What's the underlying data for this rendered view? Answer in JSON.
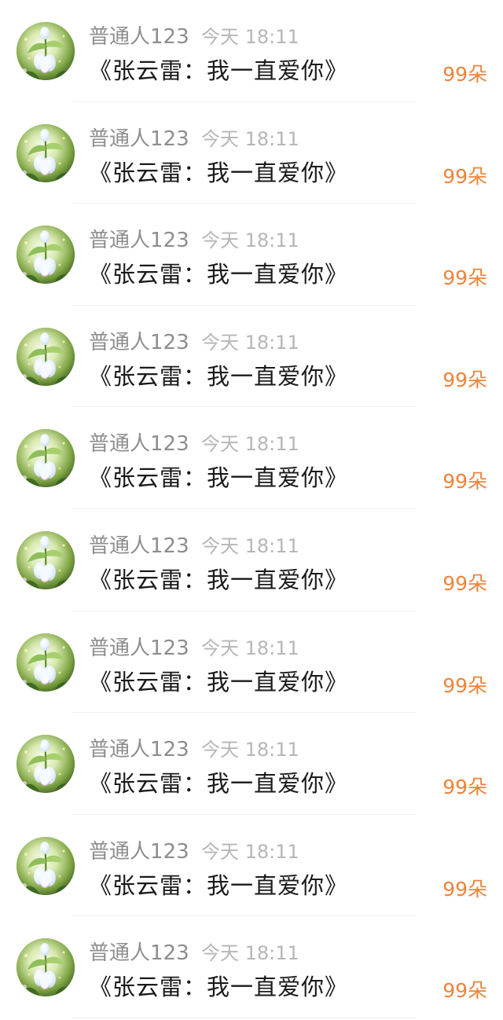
{
  "colors": {
    "background": "#ffffff",
    "name": "#8d8d8d",
    "time": "#b6b6b6",
    "title": "#1a1a1a",
    "count_accent": "#f0833a"
  },
  "avatar_icon": "snowdrop-flower-avatar",
  "items": [
    {
      "name": "普通人123",
      "time": "今天 18:11",
      "title": "《张云雷：我一直爱你》",
      "count": "99朵"
    },
    {
      "name": "普通人123",
      "time": "今天 18:11",
      "title": "《张云雷：我一直爱你》",
      "count": "99朵"
    },
    {
      "name": "普通人123",
      "time": "今天 18:11",
      "title": "《张云雷：我一直爱你》",
      "count": "99朵"
    },
    {
      "name": "普通人123",
      "time": "今天 18:11",
      "title": "《张云雷：我一直爱你》",
      "count": "99朵"
    },
    {
      "name": "普通人123",
      "time": "今天 18:11",
      "title": "《张云雷：我一直爱你》",
      "count": "99朵"
    },
    {
      "name": "普通人123",
      "time": "今天 18:11",
      "title": "《张云雷：我一直爱你》",
      "count": "99朵"
    },
    {
      "name": "普通人123",
      "time": "今天 18:11",
      "title": "《张云雷：我一直爱你》",
      "count": "99朵"
    },
    {
      "name": "普通人123",
      "time": "今天 18:11",
      "title": "《张云雷：我一直爱你》",
      "count": "99朵"
    },
    {
      "name": "普通人123",
      "time": "今天 18:11",
      "title": "《张云雷：我一直爱你》",
      "count": "99朵"
    },
    {
      "name": "普通人123",
      "time": "今天 18:11",
      "title": "《张云雷：我一直爱你》",
      "count": "99朵"
    }
  ]
}
